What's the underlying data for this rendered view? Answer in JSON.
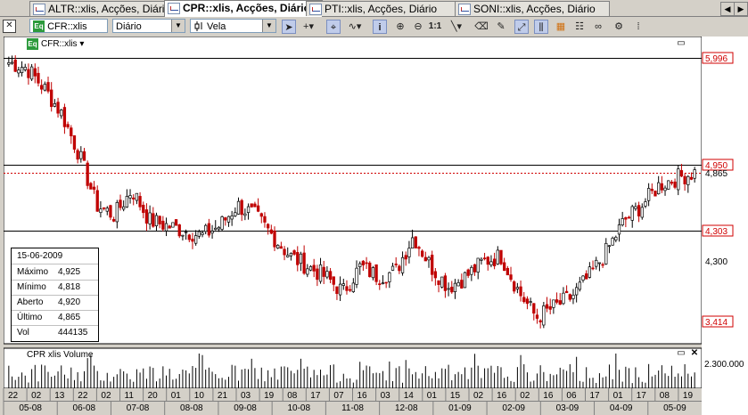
{
  "tabs": [
    {
      "label": "ALTR::xlis, Acções, Diário",
      "active": false
    },
    {
      "label": "CPR::xlis, Acções, Diário",
      "active": true
    },
    {
      "label": "PTI::xlis, Acções, Diário",
      "active": false
    },
    {
      "label": "SONI::xlis, Acções, Diário",
      "active": false
    }
  ],
  "toolbar": {
    "symbol_value": "CFR::xlis",
    "symbol_badge": "Eq",
    "period_value": "Diário",
    "chart_type_value": "Vela",
    "one_to_one": "1:1",
    "icons": [
      "pointer-icon",
      "crosshair-icon",
      "cursor-icon",
      "wave-icon",
      "info-icon",
      "zoom-in-icon",
      "zoom-out-icon",
      "one-to-one-icon",
      "trendline-icon",
      "eraser-icon",
      "pencil-icon",
      "drag-icon",
      "candles-icon",
      "grid-icon",
      "table-icon",
      "link-icon",
      "properties-icon"
    ]
  },
  "chart": {
    "series_label": "CFR::xlis",
    "series_badge": "Eq",
    "volume_panel_label": "CPR xlis Volume",
    "price_labels": [
      {
        "text": "5,996",
        "style": "boxed-red"
      },
      {
        "text": "4,950",
        "style": "boxed-red"
      },
      {
        "text": "4,865",
        "style": "plain"
      },
      {
        "text": "4,303",
        "style": "boxed-red"
      },
      {
        "text": "4,300",
        "style": "plain"
      },
      {
        "text": "3,414",
        "style": "boxed-red"
      }
    ],
    "volume_axis_label": "2.300.000",
    "x_day_labels": [
      "22",
      "02",
      "13",
      "22",
      "02",
      "11",
      "20",
      "01",
      "10",
      "21",
      "03",
      "19",
      "08",
      "17",
      "07",
      "16",
      "03",
      "14",
      "01",
      "15",
      "02",
      "16",
      "02",
      "16",
      "06",
      "17",
      "01",
      "17",
      "08",
      "19"
    ],
    "x_month_labels": [
      "05-08",
      "06-08",
      "07-08",
      "08-08",
      "09-08",
      "10-08",
      "11-08",
      "12-08",
      "01-09",
      "02-09",
      "03-09",
      "04-09",
      "05-09"
    ],
    "colors": {
      "up": "#000000",
      "down": "#c00000",
      "dashed_line": "#d00000",
      "label_red": "#d00000",
      "volume": "#000000"
    }
  },
  "infobox": {
    "date": "15-06-2009",
    "rows": [
      {
        "label": "Máximo",
        "value": "4,925"
      },
      {
        "label": "Mínimo",
        "value": "4,818"
      },
      {
        "label": "Aberto",
        "value": "4,920"
      },
      {
        "label": "Último",
        "value": "4,865"
      },
      {
        "label": "Vol",
        "value": "444135"
      }
    ]
  },
  "chart_data": {
    "type": "candlestick",
    "title": "",
    "series": [
      {
        "name": "CFR::xlis",
        "values": [
          5.95,
          5.9,
          5.7,
          5.45,
          5.05,
          4.55,
          4.45,
          4.7,
          4.4,
          4.35,
          4.3,
          4.25,
          4.35,
          4.55,
          4.45,
          4.25,
          4.05,
          3.95,
          3.85,
          3.7,
          3.95,
          3.85,
          3.9,
          4.25,
          3.95,
          3.75,
          3.85,
          4.0,
          4.05,
          3.7,
          3.45,
          3.55,
          3.65,
          3.85,
          4.1,
          4.4,
          4.55,
          4.75,
          4.82,
          4.87
        ]
      }
    ],
    "horizontal_lines": [
      5.996,
      4.95,
      4.303
    ],
    "last_value_line": 4.865,
    "ylim": [
      3.2,
      6.1
    ],
    "volume_ylim": [
      0,
      2300000
    ]
  }
}
